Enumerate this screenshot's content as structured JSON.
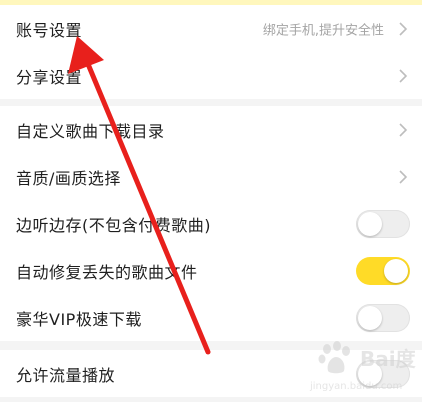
{
  "group1": {
    "rows": [
      {
        "label": "账号设置",
        "hint": "绑定手机,提升安全性",
        "chevron_icon": "chevron-right-icon"
      },
      {
        "label": "分享设置",
        "chevron_icon": "chevron-right-icon"
      }
    ]
  },
  "group2": {
    "rows": [
      {
        "label": "自定义歌曲下载目录",
        "chevron_icon": "chevron-right-icon"
      },
      {
        "label": "音质/画质选择",
        "chevron_icon": "chevron-right-icon"
      },
      {
        "label": "边听边存(不包含付费歌曲)",
        "toggle": false
      },
      {
        "label": "自动修复丢失的歌曲文件",
        "toggle": true
      },
      {
        "label": "豪华VIP极速下载",
        "toggle": false
      }
    ]
  },
  "group3": {
    "rows": [
      {
        "label": "允许流量播放",
        "toggle": false
      }
    ]
  },
  "colors": {
    "accent_toggle_on": "#ffdb27",
    "annotation_arrow": "#e8201c",
    "top_strip": "#fff7bd"
  },
  "watermark": {
    "text": "Bai度",
    "url": "jingyan.baidu.com"
  }
}
